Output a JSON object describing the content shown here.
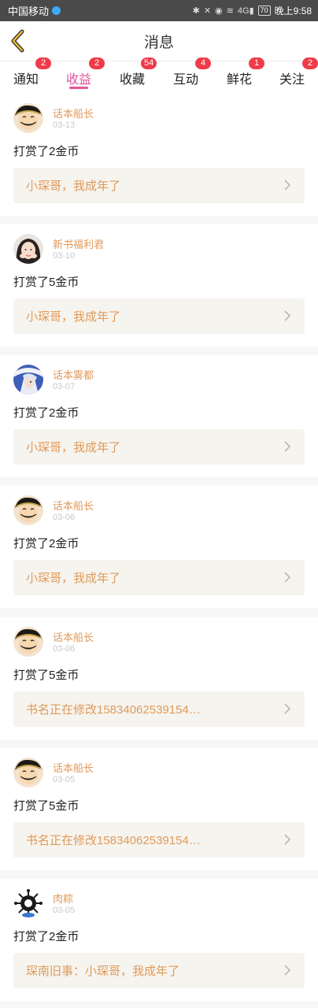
{
  "status_bar": {
    "carrier": "中国移动",
    "time": "晚上9:58",
    "battery": "70",
    "signal": "4G",
    "icons": [
      "bluetooth-icon",
      "mute-icon",
      "eye-icon",
      "wifi-icon",
      "signal-icon",
      "battery-icon"
    ]
  },
  "header": {
    "title": "消息",
    "back_icon": "chevron-left-icon"
  },
  "tabs": [
    {
      "label": "通知",
      "badge": "2",
      "active": false
    },
    {
      "label": "收益",
      "badge": "2",
      "active": true
    },
    {
      "label": "收藏",
      "badge": "54",
      "active": false
    },
    {
      "label": "互动",
      "badge": "4",
      "active": false
    },
    {
      "label": "鲜花",
      "badge": "1",
      "active": false
    },
    {
      "label": "关注",
      "badge": "2",
      "active": false
    }
  ],
  "messages": [
    {
      "user": "话本船长",
      "date": "03-13",
      "text": "打赏了2金币",
      "book": "小琛哥，我成年了",
      "avatar": "luffy-avatar"
    },
    {
      "user": "新书福利君",
      "date": "03-10",
      "text": "打赏了5金币",
      "book": "小琛哥，我成年了",
      "avatar": "girl-avatar"
    },
    {
      "user": "话本雾都",
      "date": "03-07",
      "text": "打赏了2金币",
      "book": "小琛哥，我成年了",
      "avatar": "anime-boy-avatar"
    },
    {
      "user": "话本船长",
      "date": "03-06",
      "text": "打赏了2金币",
      "book": "小琛哥，我成年了",
      "avatar": "luffy-avatar"
    },
    {
      "user": "话本船长",
      "date": "03-06",
      "text": "打赏了5金币",
      "book": "书名正在修改15834062539154…",
      "avatar": "luffy-avatar"
    },
    {
      "user": "话本船长",
      "date": "03-05",
      "text": "打赏了5金币",
      "book": "书名正在修改15834062539154…",
      "avatar": "luffy-avatar"
    },
    {
      "user": "肉粽",
      "date": "03-05",
      "text": "打赏了2金币",
      "book": "琛南旧事：小琛哥，我成年了",
      "avatar": "virus-avatar"
    }
  ],
  "colors": {
    "accent": "#e0559b",
    "badge": "#ef3b4a",
    "book_text": "#e09a5a",
    "book_box": "#f6f4ef"
  }
}
